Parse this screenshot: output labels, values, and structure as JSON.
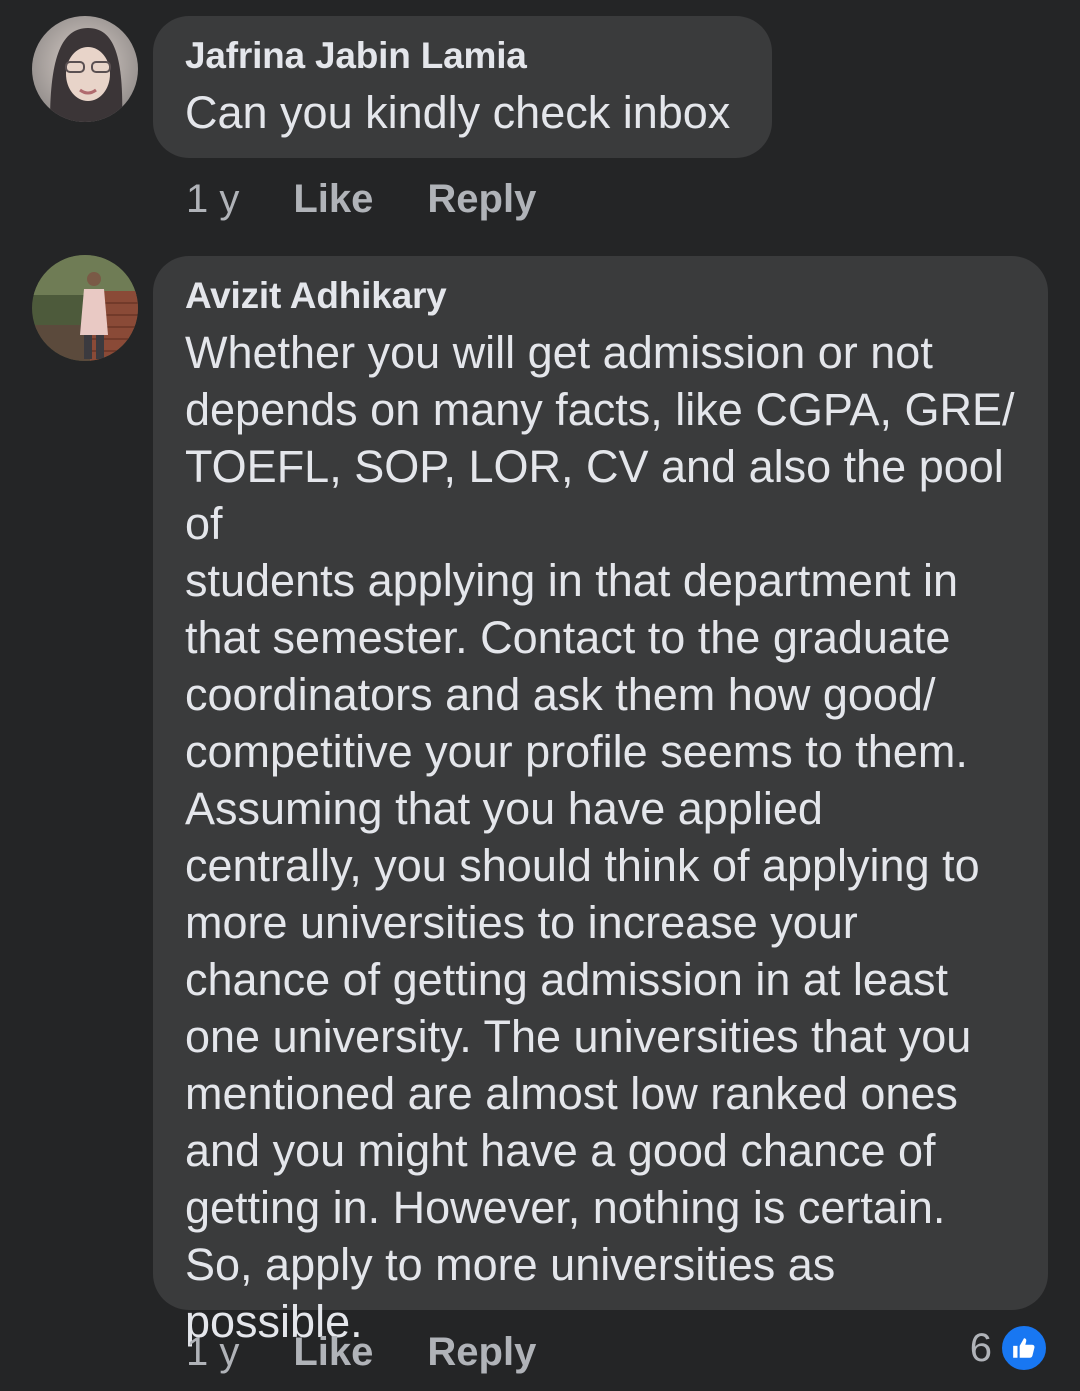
{
  "comments": [
    {
      "author": "Jafrina Jabin Lamia",
      "text": "Can you kindly check inbox",
      "time": "1 y",
      "like_label": "Like",
      "reply_label": "Reply"
    },
    {
      "author": "Avizit Adhikary",
      "text": "Whether you will get admission or not\ndepends on many facts, like CGPA, GRE/\nTOEFL, SOP, LOR, CV and also the pool of\nstudents applying in that department in\nthat semester. Contact to the graduate\ncoordinators and ask them how good/\ncompetitive your profile seems to them.\nAssuming that you have applied\ncentrally, you should think of applying to\nmore universities to increase your\nchance of getting admission in at least\none university. The universities that you\nmentioned are almost low ranked ones\nand you might have a good chance of\ngetting in. However, nothing is certain.\nSo, apply to more universities as\npossible.",
      "time": "1 y",
      "like_label": "Like",
      "reply_label": "Reply",
      "reaction_count": "6",
      "reaction_icon": "thumbs-up-icon"
    }
  ],
  "colors": {
    "background": "#242526",
    "bubble": "#3a3b3c",
    "primary_text": "#e4e6eb",
    "secondary_text": "#b0b3b8",
    "like_blue": "#1877f2"
  }
}
